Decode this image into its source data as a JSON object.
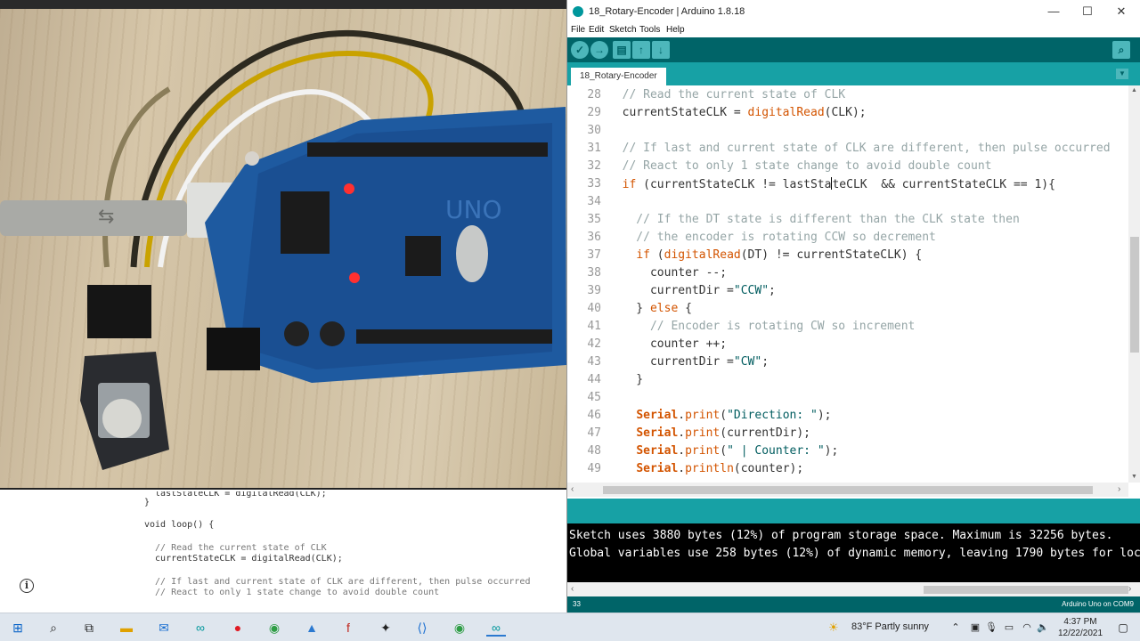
{
  "window": {
    "title": "18_Rotary-Encoder | Arduino 1.8.18",
    "minimize": "—",
    "maximize": "☐",
    "close": "✕"
  },
  "menu": [
    "File",
    "Edit",
    "Sketch",
    "Tools",
    "Help"
  ],
  "toolbar": {
    "verify": "✓",
    "upload": "→",
    "new": "▤",
    "open": "↑",
    "save": "↓",
    "serial_monitor": "⌕"
  },
  "tab": {
    "label": "18_Rotary-Encoder",
    "menu": "▼"
  },
  "editor": {
    "lines": [
      {
        "n": "28",
        "parts": [
          [
            "  // Read the current state of CLK",
            "cm"
          ]
        ]
      },
      {
        "n": "29",
        "parts": [
          [
            "  currentStateCLK = ",
            ""
          ],
          [
            "digitalRead",
            "kw"
          ],
          [
            "(CLK);",
            ""
          ]
        ]
      },
      {
        "n": "30",
        "parts": [
          [
            "",
            ""
          ]
        ]
      },
      {
        "n": "31",
        "parts": [
          [
            "  // If last and current state of CLK are different, then pulse occurred",
            "cm"
          ]
        ]
      },
      {
        "n": "32",
        "parts": [
          [
            "  // React to only 1 state change to avoid double count",
            "cm"
          ]
        ]
      },
      {
        "n": "33",
        "parts": [
          [
            "  ",
            ""
          ],
          [
            "if",
            "kw"
          ],
          [
            " (currentStateCLK != lastSta",
            ""
          ],
          [
            "|",
            "caret"
          ],
          [
            "teCLK  && currentStateCLK == 1){",
            ""
          ]
        ]
      },
      {
        "n": "34",
        "parts": [
          [
            "",
            ""
          ]
        ]
      },
      {
        "n": "35",
        "parts": [
          [
            "    // If the DT state is different than the CLK state then",
            "cm"
          ]
        ]
      },
      {
        "n": "36",
        "parts": [
          [
            "    // the encoder is rotating CCW so decrement",
            "cm"
          ]
        ]
      },
      {
        "n": "37",
        "parts": [
          [
            "    ",
            ""
          ],
          [
            "if",
            "kw"
          ],
          [
            " (",
            ""
          ],
          [
            "digitalRead",
            "kw"
          ],
          [
            "(DT) != currentStateCLK) {",
            ""
          ]
        ]
      },
      {
        "n": "38",
        "parts": [
          [
            "      counter --;",
            ""
          ]
        ]
      },
      {
        "n": "39",
        "parts": [
          [
            "      currentDir =",
            ""
          ],
          [
            "\"CCW\"",
            "str"
          ],
          [
            ";",
            ""
          ]
        ]
      },
      {
        "n": "40",
        "parts": [
          [
            "    } ",
            ""
          ],
          [
            "else",
            "kw"
          ],
          [
            " {",
            ""
          ]
        ]
      },
      {
        "n": "41",
        "parts": [
          [
            "      // Encoder is rotating CW so increment",
            "cm"
          ]
        ]
      },
      {
        "n": "42",
        "parts": [
          [
            "      counter ++;",
            ""
          ]
        ]
      },
      {
        "n": "43",
        "parts": [
          [
            "      currentDir =",
            ""
          ],
          [
            "\"CW\"",
            "str"
          ],
          [
            ";",
            ""
          ]
        ]
      },
      {
        "n": "44",
        "parts": [
          [
            "    }",
            ""
          ]
        ]
      },
      {
        "n": "45",
        "parts": [
          [
            "",
            ""
          ]
        ]
      },
      {
        "n": "46",
        "parts": [
          [
            "    ",
            ""
          ],
          [
            "Serial",
            "ty"
          ],
          [
            ".",
            ""
          ],
          [
            "print",
            "kw"
          ],
          [
            "(",
            ""
          ],
          [
            "\"Direction: \"",
            "str"
          ],
          [
            ");",
            ""
          ]
        ]
      },
      {
        "n": "47",
        "parts": [
          [
            "    ",
            ""
          ],
          [
            "Serial",
            "ty"
          ],
          [
            ".",
            ""
          ],
          [
            "print",
            "kw"
          ],
          [
            "(currentDir);",
            ""
          ]
        ]
      },
      {
        "n": "48",
        "parts": [
          [
            "    ",
            ""
          ],
          [
            "Serial",
            "ty"
          ],
          [
            ".",
            ""
          ],
          [
            "print",
            "kw"
          ],
          [
            "(",
            ""
          ],
          [
            "\" | Counter: \"",
            "str"
          ],
          [
            ");",
            ""
          ]
        ]
      },
      {
        "n": "49",
        "parts": [
          [
            "    ",
            ""
          ],
          [
            "Serial",
            "ty"
          ],
          [
            ".",
            ""
          ],
          [
            "println",
            "kw"
          ],
          [
            "(counter);",
            ""
          ]
        ]
      }
    ]
  },
  "console": {
    "line1": "Sketch uses 3880 bytes (12%) of program storage space. Maximum is 32256 bytes.",
    "line2": "Global variables use 258 bytes (12%) of dynamic memory, leaving 1790 bytes for local variables."
  },
  "footer": {
    "line": "33",
    "board": "Arduino Uno on COM9"
  },
  "doc": {
    "lines": [
      {
        "text": "  lastStateCLK = digitalRead(CLK);",
        "cls": ""
      },
      {
        "text": "}",
        "cls": ""
      },
      {
        "text": "",
        "cls": ""
      },
      {
        "text": "void loop() {",
        "cls": ""
      },
      {
        "text": "",
        "cls": ""
      },
      {
        "text": "  // Read the current state of CLK",
        "cls": "cm"
      },
      {
        "text": "  currentStateCLK = digitalRead(CLK);",
        "cls": ""
      },
      {
        "text": "",
        "cls": ""
      },
      {
        "text": "  // If last and current state of CLK are different, then pulse occurred",
        "cls": "cm"
      },
      {
        "text": "  // React to only 1 state change to avoid double count",
        "cls": "cm"
      }
    ],
    "info": "i"
  },
  "taskbar": {
    "weather": "83°F  Partly sunny",
    "time": "4:37 PM",
    "date": "12/22/2021"
  },
  "colors": {
    "teal_dark": "#006468",
    "teal": "#17a1a5",
    "keyword": "#d35400",
    "comment": "#95a5a6"
  }
}
